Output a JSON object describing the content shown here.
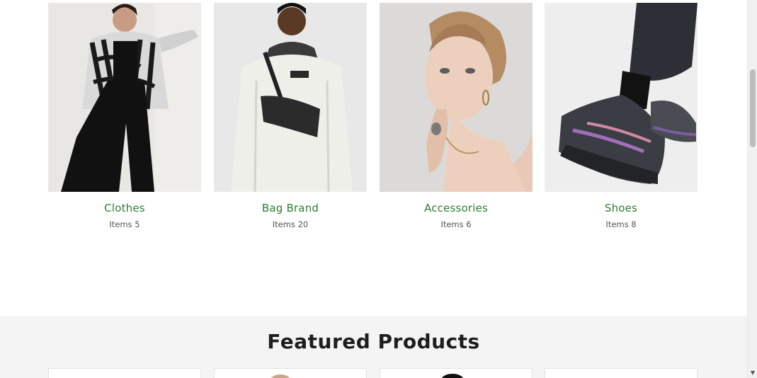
{
  "categories": {
    "items": [
      {
        "name": "Clothes",
        "count": "Items 5",
        "icon": "clothes-photo"
      },
      {
        "name": "Bag Brand",
        "count": "Items 20",
        "icon": "bag-photo"
      },
      {
        "name": "Accessories",
        "count": "Items 6",
        "icon": "accessories-photo"
      },
      {
        "name": "Shoes",
        "count": "Items 8",
        "icon": "shoes-photo"
      }
    ]
  },
  "featured": {
    "title": "Featured Products"
  },
  "colors": {
    "accent": "#2e7d32",
    "section_bg": "#f4f4f4"
  }
}
